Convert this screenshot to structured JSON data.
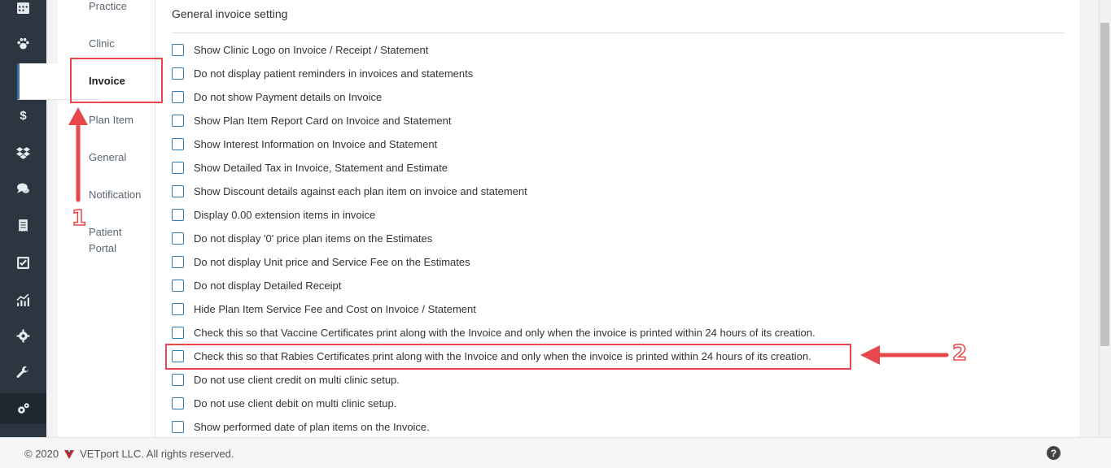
{
  "rail_icons": [
    "calendar-icon",
    "paw-icon",
    "flask-icon",
    "dollar-icon",
    "dropbox-icon",
    "chat-icon",
    "receipt-icon",
    "checkbox-icon",
    "chart-icon",
    "gear-icon",
    "wrench-icon",
    "gears-icon"
  ],
  "rail_glyphs": {
    "dollar": "$"
  },
  "submenu": {
    "items": [
      "Practice",
      "Clinic",
      "Invoice",
      "Plan Item",
      "General",
      "Notification",
      "Patient Portal"
    ],
    "active": "Invoice"
  },
  "section": {
    "title": "General invoice setting"
  },
  "options": [
    {
      "label": "Show Clinic Logo on Invoice / Receipt / Statement",
      "checked": false
    },
    {
      "label": "Do not display patient reminders in invoices and statements",
      "checked": false
    },
    {
      "label": "Do not show Payment details on Invoice",
      "checked": false
    },
    {
      "label": "Show Plan Item Report Card on Invoice and Statement",
      "checked": false
    },
    {
      "label": "Show Interest Information on Invoice and Statement",
      "checked": false
    },
    {
      "label": "Show Detailed Tax in Invoice, Statement and Estimate",
      "checked": false
    },
    {
      "label": "Show Discount details against each plan item on invoice and statement",
      "checked": false
    },
    {
      "label": "Display 0.00 extension items in invoice",
      "checked": false
    },
    {
      "label": "Do not display '0' price plan items on the Estimates",
      "checked": false
    },
    {
      "label": "Do not display Unit price and Service Fee on the Estimates",
      "checked": false
    },
    {
      "label": "Do not display Detailed Receipt",
      "checked": false
    },
    {
      "label": "Hide Plan Item Service Fee and Cost on Invoice / Statement",
      "checked": false
    },
    {
      "label": "Check this so that Vaccine Certificates print along with the Invoice and only when the invoice is printed within 24 hours of its creation.",
      "checked": false
    },
    {
      "label": "Check this so that Rabies Certificates print along with the Invoice and only when the invoice is printed within 24 hours of its creation.",
      "checked": false
    },
    {
      "label": "Do not use client credit on multi clinic setup.",
      "checked": false
    },
    {
      "label": "Do not use client debit on multi clinic setup.",
      "checked": false
    },
    {
      "label": "Show performed date of plan items on the Invoice.",
      "checked": false
    }
  ],
  "footer": {
    "copyright": "© 2020",
    "company": "VETport LLC. All rights reserved.",
    "help": "?"
  },
  "annotations": {
    "step1": "1",
    "step2": "2"
  },
  "colors": {
    "rail": "#2b3640",
    "checkbox_border": "#2f7ab8",
    "annotation": "#e8474b"
  }
}
